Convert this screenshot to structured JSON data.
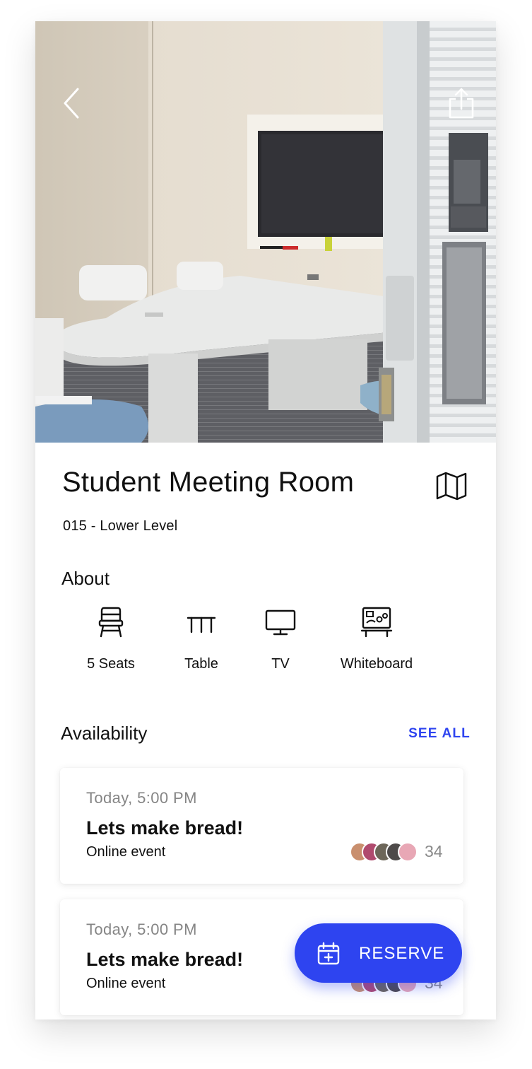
{
  "room": {
    "title": "Student Meeting Room",
    "location": "015 - Lower Level"
  },
  "icons": {
    "back": "chevron-left-icon",
    "share": "share-icon",
    "map": "map-icon",
    "reserve": "calendar-plus-icon"
  },
  "about": {
    "heading": "About",
    "amenities": [
      {
        "icon": "chair-icon",
        "label": "5 Seats"
      },
      {
        "icon": "table-icon",
        "label": "Table"
      },
      {
        "icon": "tv-icon",
        "label": "TV"
      },
      {
        "icon": "whiteboard-icon",
        "label": "Whiteboard"
      }
    ]
  },
  "availability": {
    "heading": "Availability",
    "see_all": "SEE ALL",
    "events": [
      {
        "time": "Today, 5:00 PM",
        "title": "Lets make bread!",
        "type": "Online event",
        "attendees": "34"
      },
      {
        "time": "Today, 5:00 PM",
        "title": "Lets make bread!",
        "type": "Online event",
        "attendees": "34"
      }
    ]
  },
  "reserve_label": "RESERVE",
  "colors": {
    "accent": "#2e44f0",
    "muted_text": "#858585"
  }
}
